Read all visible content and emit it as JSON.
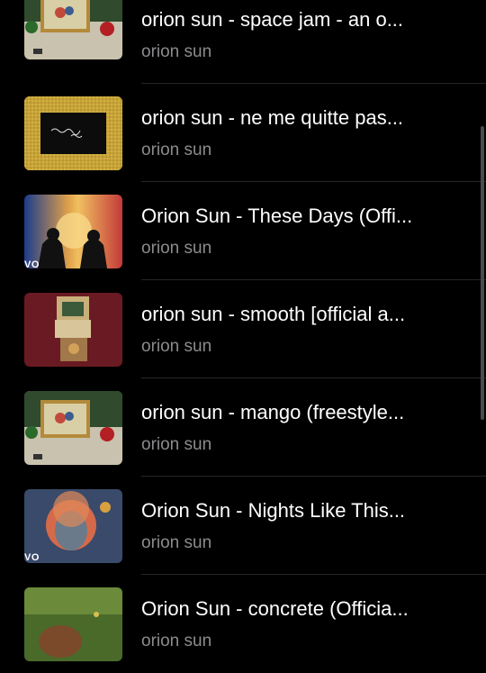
{
  "list": {
    "items": [
      {
        "title": "orion sun - space jam - an o...",
        "channel": "orion sun",
        "thumb": "album-cover-collage",
        "badge": ""
      },
      {
        "title": "orion sun - ne me quitte pas...",
        "channel": "orion sun",
        "thumb": "gold-frame-handwriting",
        "badge": ""
      },
      {
        "title": "Orion Sun - These Days (Offi...",
        "channel": "orion sun",
        "thumb": "silhouettes-sunset",
        "badge": "VO"
      },
      {
        "title": "orion sun - smooth [official a...",
        "channel": "orion sun",
        "thumb": "collage-on-maroon",
        "badge": ""
      },
      {
        "title": "orion sun - mango (freestyle...",
        "channel": "orion sun",
        "thumb": "album-cover-collage",
        "badge": ""
      },
      {
        "title": "Orion Sun - Nights Like This...",
        "channel": "orion sun",
        "thumb": "portrait-painting",
        "badge": "VO"
      },
      {
        "title": "Orion Sun - concrete (Officia...",
        "channel": "orion sun",
        "thumb": "grass-field",
        "badge": ""
      }
    ],
    "cover_text": "orion sun"
  },
  "colors": {
    "background": "#000000",
    "title": "#ffffff",
    "subtitle": "#8c8c8f",
    "divider": "#262628"
  }
}
